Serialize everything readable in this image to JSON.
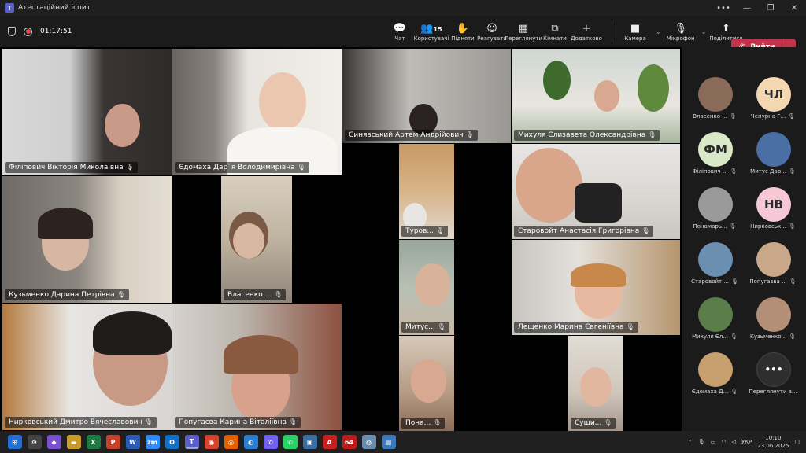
{
  "window": {
    "title": "Атестаційний іспит",
    "controls": [
      "•••",
      "—",
      "❐",
      "✕"
    ]
  },
  "meeting": {
    "elapsed": "01:17:51"
  },
  "toolbar": {
    "items": [
      {
        "icon": "💬",
        "label": "Чат"
      },
      {
        "icon": "👥",
        "label": "Користувачі",
        "count": "15"
      },
      {
        "icon": "✋",
        "label": "Підняти"
      },
      {
        "icon": "☺",
        "label": "Реагувати"
      },
      {
        "icon": "▦",
        "label": "Переглянути"
      },
      {
        "icon": "⧉",
        "label": "Кімнати"
      },
      {
        "icon": "+",
        "label": "Додатково"
      }
    ],
    "camera": {
      "icon": "■",
      "label": "Камера"
    },
    "mic": {
      "icon": "🎙",
      "label": "Мікрофон"
    },
    "share": {
      "icon": "⬆",
      "label": "Поділитися"
    },
    "leave_label": "Вийти"
  },
  "tiles": [
    {
      "name": "Філіпович Вікторія Миколаївна"
    },
    {
      "name": "Єдомаха Дар`я Володимирівна"
    },
    {
      "name": "Синявський Артем Андрійович"
    },
    {
      "name": "Михуля Єлизавета Олександрівна"
    },
    {
      "name": "Кузьменко Дарина Петрівна"
    },
    {
      "name": "Власенко ..."
    },
    {
      "name": "Туров..."
    },
    {
      "name": "Старовойт Анастасія Григорівна"
    },
    {
      "name": "Митус..."
    },
    {
      "name": "Лещенко Марина Євгеніївна"
    },
    {
      "name": "Нирковський Дмитро Вячеславович"
    },
    {
      "name": "Попугаєва Карина Віталіївна"
    },
    {
      "name": "Пона..."
    },
    {
      "name": "Суши..."
    }
  ],
  "panel": {
    "participants": [
      {
        "name": "Власенко ...",
        "initials": "",
        "color": "#8a6a58"
      },
      {
        "name": "Чепурна Г...",
        "initials": "ЧЛ",
        "color": "#f3d7b0"
      },
      {
        "name": "Філіпович ...",
        "initials": "ФМ",
        "color": "#d9e8c6"
      },
      {
        "name": "Митус Дар...",
        "initials": "",
        "color": "#4a6fa5"
      },
      {
        "name": "Понамарь...",
        "initials": "",
        "color": "#9a9a9a"
      },
      {
        "name": "Нирковськ...",
        "initials": "НВ",
        "color": "#f6c8d6"
      },
      {
        "name": "Старовойт ...",
        "initials": "",
        "color": "#6a8fb0"
      },
      {
        "name": "Попугаєва ...",
        "initials": "",
        "color": "#c9a88a"
      },
      {
        "name": "Михуля Єл...",
        "initials": "",
        "color": "#5a7d4a"
      },
      {
        "name": "Кузьменко...",
        "initials": "",
        "color": "#b48f78"
      },
      {
        "name": "Єдомаха Д...",
        "initials": "",
        "color": "#c8a070"
      }
    ],
    "more": {
      "icon": "•••",
      "label": "Переглянути в..."
    }
  },
  "taskbar": {
    "apps": [
      {
        "icon": "⊞",
        "color": "#1f6fd6"
      },
      {
        "icon": "⚙",
        "color": "#444"
      },
      {
        "icon": "◆",
        "color": "#7a4fd0"
      },
      {
        "icon": "▬",
        "color": "#c79a2a"
      },
      {
        "icon": "X",
        "color": "#1d7a43"
      },
      {
        "icon": "P",
        "color": "#c4432a"
      },
      {
        "icon": "W",
        "color": "#2a5bb8"
      },
      {
        "icon": "zm",
        "color": "#2d8cff"
      },
      {
        "icon": "O",
        "color": "#1170c8"
      },
      {
        "icon": "T",
        "color": "#5b5fc7"
      },
      {
        "icon": "◉",
        "color": "#d8432f"
      },
      {
        "icon": "◎",
        "color": "#e66000"
      },
      {
        "icon": "◐",
        "color": "#2a7fd0"
      },
      {
        "icon": "✆",
        "color": "#7360f2"
      },
      {
        "icon": "✆",
        "color": "#25d366"
      },
      {
        "icon": "▣",
        "color": "#3a6ea5"
      },
      {
        "icon": "A",
        "color": "#c8201c"
      },
      {
        "icon": "64",
        "color": "#c01a1a"
      },
      {
        "icon": "◍",
        "color": "#6a8caf"
      },
      {
        "icon": "▤",
        "color": "#3a78c0"
      }
    ],
    "lang": "УКР",
    "time": "10:10",
    "date": "23.06.2025"
  }
}
